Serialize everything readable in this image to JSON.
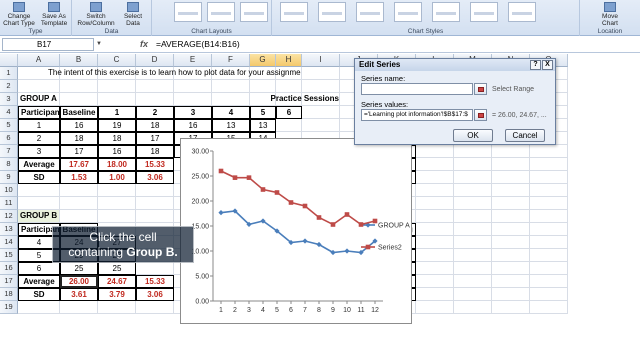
{
  "ribbon": {
    "groups": [
      {
        "label": "Type",
        "buttons": [
          "Change Chart Type",
          "Save As Template"
        ]
      },
      {
        "label": "Data",
        "buttons": [
          "Switch Row/Column",
          "Select Data"
        ]
      },
      {
        "label": "Chart Layouts"
      },
      {
        "label": "Chart Styles"
      },
      {
        "label": "Location",
        "buttons": [
          "Move Chart"
        ]
      }
    ],
    "type_btn1_l1": "Change",
    "type_btn1_l2": "Chart Type",
    "type_btn2_l1": "Save As",
    "type_btn2_l2": "Template",
    "data_btn1_l1": "Switch",
    "data_btn1_l2": "Row/Column",
    "data_btn2_l1": "Select",
    "data_btn2_l2": "Data",
    "loc_btn_l1": "Move",
    "loc_btn_l2": "Chart",
    "type_label": "Type",
    "data_label": "Data",
    "layouts_label": "Chart Layouts",
    "styles_label": "Chart Styles",
    "location_label": "Location"
  },
  "formula_bar": {
    "name_box": "B17",
    "fx": "fx",
    "formula": "=AVERAGE(B14:B16)"
  },
  "columns": [
    "A",
    "B",
    "C",
    "D",
    "E",
    "F",
    "G",
    "H",
    "I",
    "J",
    "K",
    "L",
    "M",
    "N",
    "O"
  ],
  "selected_columns": [
    "G",
    "H"
  ],
  "rows": [
    "1",
    "2",
    "3",
    "4",
    "5",
    "6",
    "7",
    "8",
    "9",
    "10",
    "11",
    "12",
    "13",
    "14",
    "15",
    "16",
    "17",
    "18",
    "19"
  ],
  "sheet": {
    "r1_text": "The intent of this exercise is to learn how to plot data for your assignment",
    "group_a": "GROUP A",
    "practice_sessions": "Practice Sessions",
    "participant": "Participant",
    "baseline": "Baseline",
    "sessions": [
      "1",
      "2",
      "3",
      "4",
      "5",
      "6"
    ],
    "r4": [
      "1",
      "16",
      "19",
      "18",
      "16",
      "13",
      "13"
    ],
    "r5": [
      "2",
      "18",
      "18",
      "17",
      "17",
      "15",
      "14"
    ],
    "r6": [
      "3",
      "17",
      "16",
      "18",
      "18",
      "15",
      "13"
    ],
    "avg_label": "Average",
    "avg_a": [
      "17.67",
      "18.00",
      "15.33"
    ],
    "sd_label": "SD",
    "sd_a": [
      "1.53",
      "1.00",
      "3.06"
    ],
    "right_r4": "19",
    "right_r5": "10",
    "right_r6": "11",
    "right_avg": [
      "67",
      "12.00"
    ],
    "right_sd": [
      "58",
      "1.00"
    ],
    "group_b": "GROUP B",
    "participant_b": "Participant",
    "baseline_b": "Baseline",
    "r14": [
      "4",
      "24",
      "27"
    ],
    "r15": [
      "5",
      "29",
      "23"
    ],
    "r16": [
      "6",
      "25",
      "25"
    ],
    "avg_b": [
      "26.00",
      "24.67",
      "15.33"
    ],
    "sd_b": [
      "3.61",
      "3.79",
      "3.06"
    ],
    "right_hdr_b": [
      "10",
      "Learning Test"
    ],
    "right_r14": "19",
    "right_r15": "13",
    "right_r16": "16",
    "right_avg_b": [
      "33",
      "16.00"
    ],
    "right_sd_b": [
      "16",
      "2.65"
    ]
  },
  "chart_data": {
    "type": "line",
    "x": [
      1,
      2,
      3,
      4,
      5,
      6,
      7,
      8,
      9,
      10,
      11,
      12
    ],
    "series": [
      {
        "name": "GROUP A",
        "color": "#4a7ebb",
        "values": [
          17.67,
          18.0,
          15.33,
          16.0,
          14.0,
          11.7,
          12.0,
          11.3,
          9.7,
          10.0,
          9.7,
          12.0
        ]
      },
      {
        "name": "Series2",
        "color": "#be4b48",
        "values": [
          26.0,
          24.67,
          24.67,
          22.3,
          21.7,
          19.7,
          19.0,
          16.7,
          15.3,
          17.3,
          15.3,
          16.0
        ]
      }
    ],
    "ylim": [
      0,
      30
    ],
    "yticks": [
      "0.00",
      "5.00",
      "10.00",
      "15.00",
      "20.00",
      "25.00",
      "30.00"
    ],
    "xticks": [
      "1",
      "2",
      "3",
      "4",
      "5",
      "6",
      "7",
      "8",
      "9",
      "10",
      "11",
      "12"
    ],
    "legend": "right"
  },
  "dialog": {
    "title": "Edit Series",
    "help": "?",
    "close": "X",
    "series_name_label": "Series name:",
    "series_name_value": "",
    "select_range": "Select Range",
    "series_values_label": "Series values:",
    "series_values_value": "='Learning plot information'!$B$17:$",
    "preview": "= 26.00, 24.67, ...",
    "ok": "OK",
    "cancel": "Cancel"
  },
  "callout": {
    "line1": "Click the cell",
    "line2_pre": "containing ",
    "line2_bold": "Group B."
  }
}
